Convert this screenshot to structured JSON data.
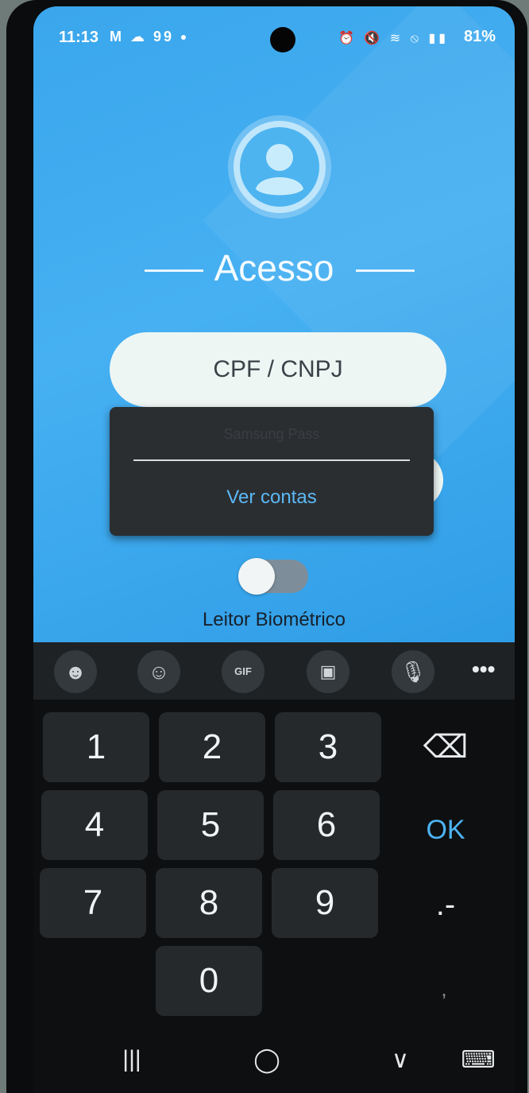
{
  "status_bar": {
    "time": "11:13",
    "left_icons": "M ☁ 99",
    "right_icons": "⏰ 🔇 ≋ ⦸ ▮▮",
    "battery": "81%"
  },
  "login": {
    "title": "Acesso",
    "document_field_placeholder": "CPF / CNPJ",
    "biometric_label": "Leitor Biométrico",
    "biometric_enabled": false
  },
  "autofill_popup": {
    "hint": "Samsung Pass",
    "action": "Ver contas"
  },
  "keyboard_toolbar": {
    "items": [
      "emoji-icon",
      "sticker-icon",
      "gif-icon",
      "clipboard-icon",
      "microphone-icon"
    ],
    "more": "•••"
  },
  "keypad": {
    "digits": [
      "1",
      "2",
      "3",
      "4",
      "5",
      "6",
      "7",
      "8",
      "9",
      "0"
    ],
    "ok_label": "OK",
    "punct_label": ".-",
    "comma_label": ","
  },
  "nav_bar": {
    "recents": "|||",
    "home": "◯",
    "back": "∨",
    "keyboard": "⌨"
  },
  "colors": {
    "app_background": "#3aa6ec",
    "accent": "#4db3f3"
  }
}
